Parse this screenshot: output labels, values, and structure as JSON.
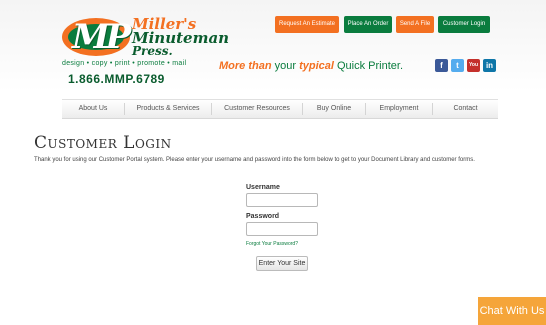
{
  "brand": {
    "line1": "Miller's",
    "line2": "Minuteman",
    "line3": "Press.",
    "tagline": "design • copy • print • promote • mail",
    "phone": "1.866.MMP.6789",
    "logo_mark": "MP"
  },
  "header_buttons": {
    "estimate": "Request An Estimate",
    "order": "Place An Order",
    "send_file": "Send A File",
    "customer_login": "Customer Login"
  },
  "slogan": {
    "part1": "More than",
    "part2": " your ",
    "part3": "typical",
    "part4": " Quick Printer."
  },
  "social": {
    "facebook": "f",
    "twitter": "t",
    "youtube": "You",
    "linkedin": "in"
  },
  "nav": {
    "about": "About Us",
    "products": "Products & Services",
    "resources": "Customer Resources",
    "buy": "Buy Online",
    "employment": "Employment",
    "contact": "Contact"
  },
  "page": {
    "title": "Customer Login",
    "intro": "Thank you for using our Customer Portal system. Please enter your username and password into the form below to get to your Document Library and customer forms."
  },
  "form": {
    "username_label": "Username",
    "username_value": "",
    "password_label": "Password",
    "password_value": "",
    "forgot": "Forgot Your Password?",
    "submit": "Enter Your Site"
  },
  "chat": {
    "label": "Chat With Us"
  },
  "colors": {
    "orange": "#f37021",
    "green": "#0a7c3e",
    "chat": "#f5a53a"
  }
}
